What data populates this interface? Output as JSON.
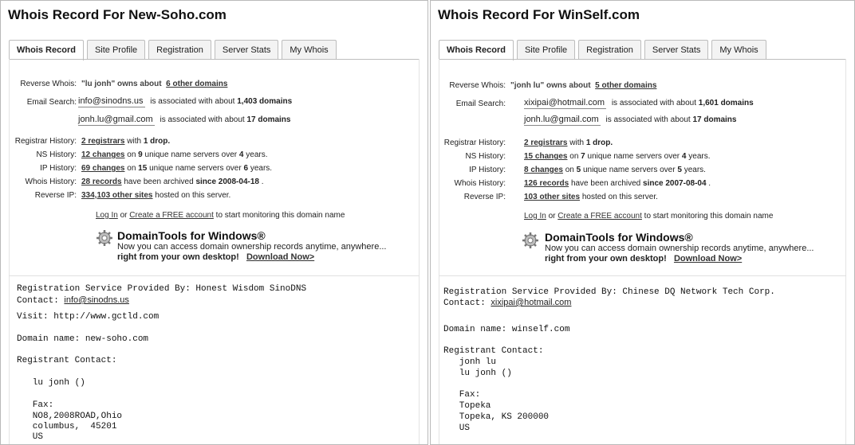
{
  "tabs": [
    "Whois Record",
    "Site Profile",
    "Registration",
    "Server Stats",
    "My Whois"
  ],
  "labels": {
    "reverse_whois": "Reverse Whois:",
    "email_search": "Email Search:",
    "registrar_history": "Registrar History:",
    "ns_history": "NS History:",
    "ip_history": "IP History:",
    "whois_history": "Whois History:",
    "reverse_ip": "Reverse IP:"
  },
  "common": {
    "owns_about": "owns about",
    "associated_with_about": "is associated with about",
    "with": "with",
    "drop": "1 drop.",
    "on": "on",
    "unique_name_servers_over": "unique name servers over",
    "years": "years.",
    "have_been_archived": "have been archived",
    "hosted_on_this_server": "hosted on this server.",
    "log_in": "Log In",
    "or": "or",
    "create_account": "Create a FREE account",
    "start_monitoring": "to start monitoring this domain name",
    "dt_title": "DomainTools for Windows®",
    "dt_line1": "Now you can access domain ownership records anytime, anywhere...",
    "dt_line2": "right from your own desktop!",
    "dt_download": "Download Now>"
  },
  "left": {
    "title": "Whois Record For New-Soho.com",
    "reverse_whois_name": "\"lu jonh\"",
    "reverse_whois_link": "6 other domains",
    "email1": "info@sinodns.us",
    "email1_count": "1,403 domains",
    "email2": "jonh.lu@gmail.com",
    "email2_count": "17 domains",
    "registrars": "2 registrars",
    "ns_changes": "12 changes",
    "ns_servers": "9",
    "ns_years": "4",
    "ip_changes": "69 changes",
    "ip_servers": "15",
    "ip_years": "6",
    "whois_records": "28 records",
    "whois_since": "since 2008-04-18",
    "reverse_ip": "334,103 other sites",
    "record_line1": "Registration Service Provided By: Honest Wisdom SinoDNS",
    "record_contact_label": "Contact: ",
    "record_contact_email": "info@sinodns.us",
    "record_visit": "Visit: http://www.gctld.com",
    "record_domain": "Domain name: new-soho.com",
    "record_registrant": "Registrant Contact:",
    "record_name": "   lu jonh ()",
    "record_fax": "   Fax:",
    "record_addr1": "   NO8,2008ROAD,Ohio",
    "record_addr2": "   columbus,  45201",
    "record_country": "   US"
  },
  "right": {
    "title": "Whois Record For WinSelf.com",
    "reverse_whois_name": "\"jonh lu\"",
    "reverse_whois_link": "5 other domains",
    "email1": "xixipai@hotmail.com",
    "email1_count": "1,601 domains",
    "email2": "jonh.lu@gmail.com",
    "email2_count": "17 domains",
    "registrars": "2 registrars",
    "ns_changes": "15 changes",
    "ns_servers": "7",
    "ns_years": "4",
    "ip_changes": "8 changes",
    "ip_servers": "5",
    "ip_years": "5",
    "whois_records": "126 records",
    "whois_since": "since 2007-08-04",
    "reverse_ip": "103 other sites",
    "record_line1": "Registration Service Provided By: Chinese DQ Network Tech Corp.",
    "record_contact_label": "Contact: ",
    "record_contact_email": "xixipai@hotmail.com",
    "record_domain": "Domain name: winself.com",
    "record_registrant": "Registrant Contact:",
    "record_name1": "   jonh lu",
    "record_name2": "   lu jonh ()",
    "record_fax": "   Fax:",
    "record_addr1": "   Topeka",
    "record_addr2": "   Topeka, KS 200000",
    "record_country": "   US"
  }
}
